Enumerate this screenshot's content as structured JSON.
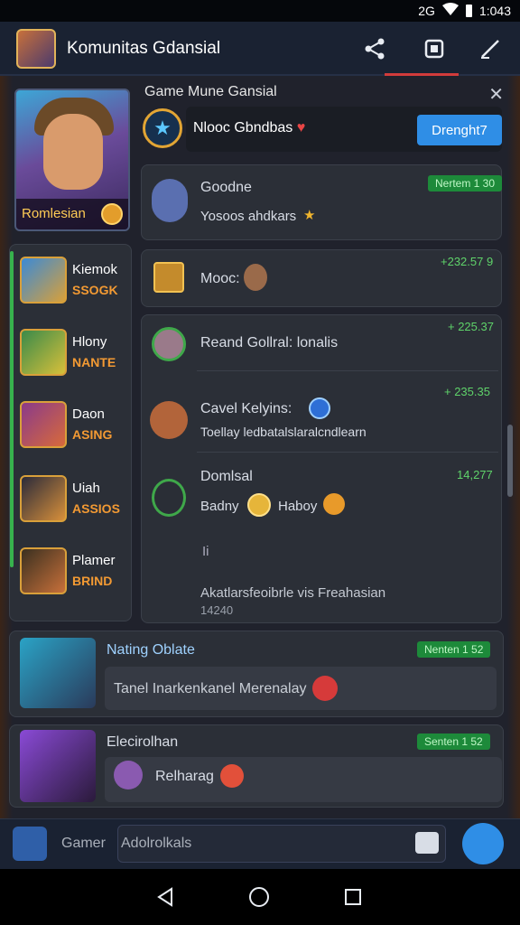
{
  "status": {
    "signal": "2G",
    "time": "1:043"
  },
  "appbar": {
    "title": "Komunitas Gdansial"
  },
  "hero": {
    "label": "Romlesian"
  },
  "section": {
    "title": "Game Mune Gansial",
    "input_text": "Nlooc Gbndbas",
    "button": "Drenght7"
  },
  "cards": {
    "c1": {
      "name": "Goodne",
      "text": "Yosoos ahdkars",
      "tag": "Nertem 1 30"
    },
    "c2": {
      "name": "Mooc",
      "num": "+232.57 9"
    },
    "c3": {
      "text": "Reand Gollral: lonalis",
      "num": "+ 225.37"
    },
    "c4": {
      "name": "Cavel Kelyins:",
      "text": "Toellay ledbatalslaralcndlearn",
      "num": "+ 235.35"
    },
    "c5": {
      "name": "Domlsal",
      "text1": "Badny",
      "text2": "Haboy",
      "letter": "Ii",
      "footer": "Akatlarsfeoibrle vis Freahasian",
      "sub": "14240",
      "num": "14,277"
    },
    "c6": {
      "name": "Nating Oblate",
      "text": "Tanel Inarkenkanel Merenalay",
      "tag": "Nenten 1 52"
    },
    "c7": {
      "name": "Elecirolhan",
      "text": "Relharag",
      "tag": "Senten 1 52"
    }
  },
  "sidebar": {
    "items": [
      {
        "name": "Kiemok",
        "sub": "SSOGK"
      },
      {
        "name": "Hlony",
        "sub": "NANTE"
      },
      {
        "name": "Daon",
        "sub": "ASING"
      },
      {
        "name": "Uiah",
        "sub": "ASSIOS"
      },
      {
        "name": "Plamer",
        "sub": "BRIND"
      }
    ]
  },
  "bottom": {
    "label": "Gamer",
    "input_value": "Adolrolkals"
  },
  "colors": {
    "accent_blue": "#2f8ee6",
    "green_tag": "#1d8a3a",
    "gold": "#ffd34d",
    "orange": "#f39a33"
  }
}
